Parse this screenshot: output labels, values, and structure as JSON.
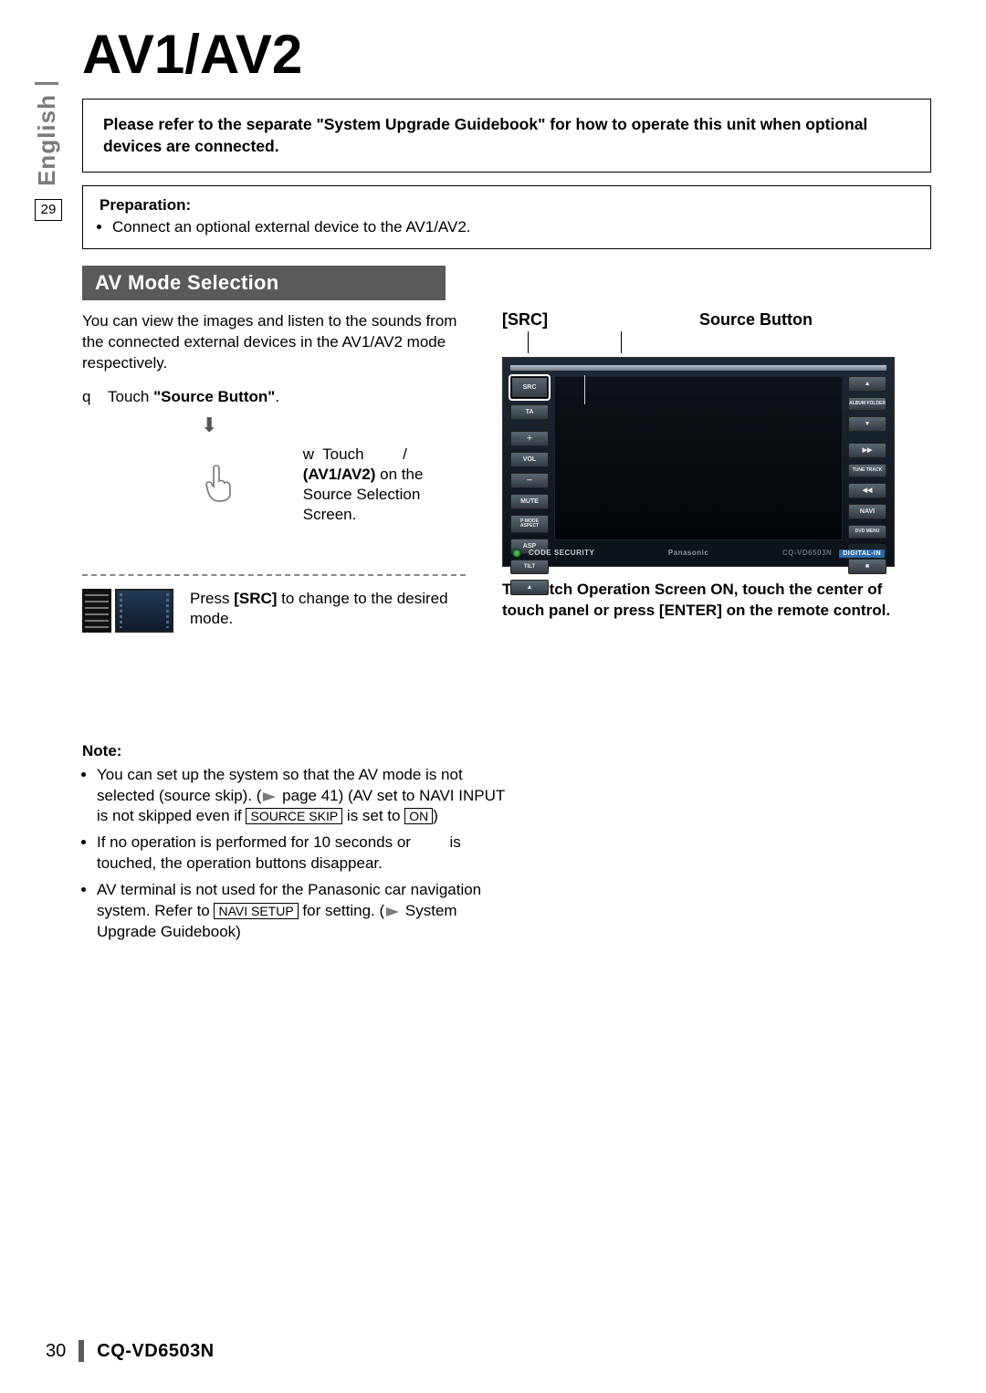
{
  "side": {
    "language": "English",
    "page_ref": "29"
  },
  "title": "AV1/AV2",
  "callout": "Please refer to the separate \"System Upgrade Guidebook\" for how to operate this unit when optional devices are connected.",
  "preparation": {
    "heading": "Preparation:",
    "items": [
      "Connect an optional external device to the AV1/AV2."
    ]
  },
  "section_heading": "AV Mode Selection",
  "intro": "You can view the images and listen to the sounds from the connected external devices in the AV1/AV2 mode respectively.",
  "steps": {
    "s1_num": "q",
    "s1_pre": "Touch ",
    "s1_bold": "\"Source Button\"",
    "s1_post": ".",
    "s2_num": "w",
    "s2_pre": "Touch ",
    "s2_mid_slash": "/",
    "s2_bold": "(AV1/AV2)",
    "s2_post": " on the Source Selection Screen."
  },
  "press_line_pre": "Press ",
  "press_line_bold": "[SRC]",
  "press_line_post": " to change to the desired mode.",
  "right": {
    "src_label": "[SRC]",
    "source_button": "Source Button",
    "buttons_left": [
      "SRC",
      "TA",
      "＋",
      "VOL",
      "－",
      "MUTE",
      "P·MODE\nASPECT",
      "ASP",
      "TILT",
      "▲"
    ],
    "buttons_right": [
      "▲",
      "ALBUM\nFOLDER",
      "▼",
      "▶▶",
      "TUNE\nTRACK",
      "◀◀",
      "NAVI",
      "DVD\nMENU",
      "",
      "■"
    ],
    "status_text": "CODE SECURITY",
    "brand": "Panasonic",
    "model": "CQ-VD6503N",
    "chip": "DIGITAL-IN",
    "under": "To switch Operation Screen ON, touch the center of touch panel or press [ENTER] on the remote control."
  },
  "note": {
    "heading": "Note:",
    "n1_a": "You can set up the system so that the AV mode is not selected (source skip). (",
    "n1_b": " page 41) (AV set to NAVI INPUT is not skipped even if ",
    "n1_key1": "SOURCE SKIP",
    "n1_c": " is set to ",
    "n1_key2": "ON",
    "n1_d": ")",
    "n2_a": "If no operation is performed for 10 seconds or ",
    "n2_b": " is touched, the operation buttons disappear.",
    "n3_a": "AV terminal is not used for the Panasonic car navigation system. Refer to ",
    "n3_key": "NAVI SETUP",
    "n3_b": " for setting. (",
    "n3_c": " System Upgrade Guidebook)"
  },
  "footer": {
    "page": "30",
    "model": "CQ-VD6503N"
  }
}
